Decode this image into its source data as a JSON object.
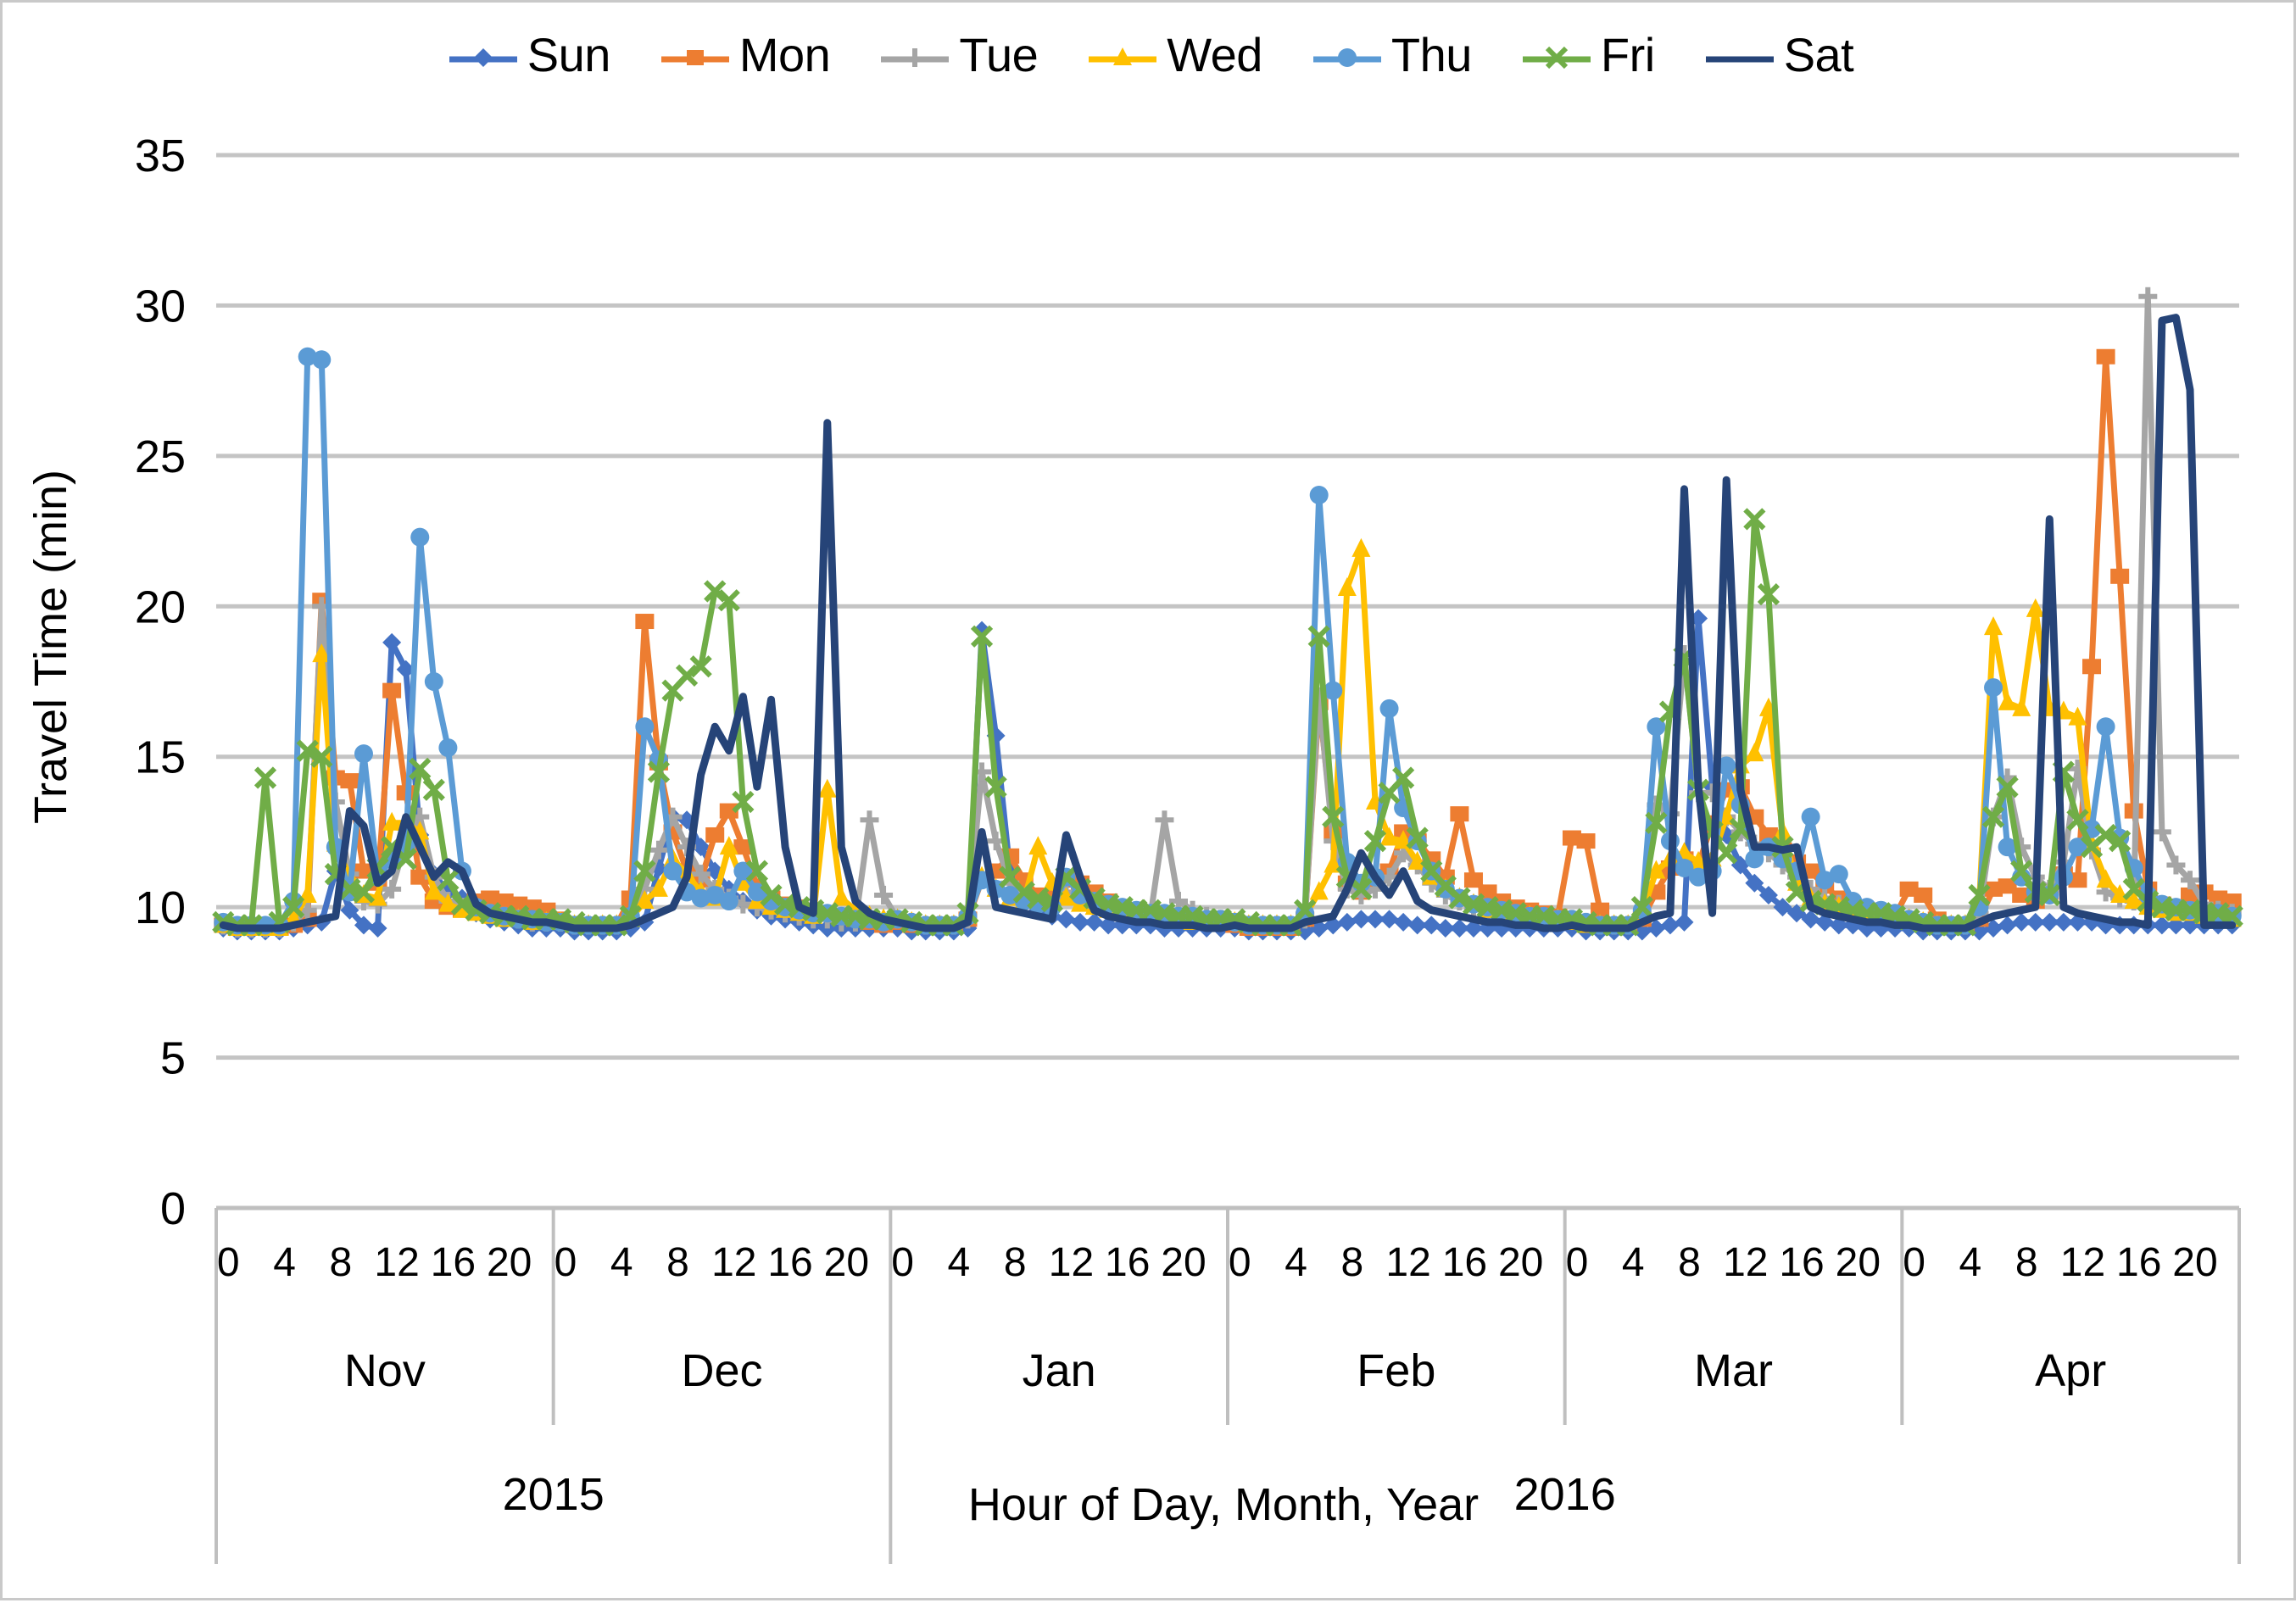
{
  "legend": {
    "position": "top-center",
    "entries": [
      {
        "label": "Sun",
        "color": "#4472C4",
        "marker": "diamond"
      },
      {
        "label": "Mon",
        "color": "#ED7D31",
        "marker": "square"
      },
      {
        "label": "Tue",
        "color": "#A5A5A5",
        "marker": "plus"
      },
      {
        "label": "Wed",
        "color": "#FFC000",
        "marker": "triangle"
      },
      {
        "label": "Thu",
        "color": "#5B9BD5",
        "marker": "circle"
      },
      {
        "label": "Fri",
        "color": "#70AD47",
        "marker": "x"
      },
      {
        "label": "Sat",
        "color": "#264478",
        "marker": "none"
      }
    ]
  },
  "axes": {
    "y_title": "Travel Time (min)",
    "y_ticks": [
      "0",
      "5",
      "10",
      "15",
      "20",
      "25",
      "30",
      "35"
    ],
    "y_min": 0,
    "y_max": 35,
    "x_title": "Hour of Day, Month, Year",
    "hour_ticks": [
      "0",
      "4",
      "8",
      "12",
      "16",
      "20"
    ],
    "months": [
      "Nov",
      "Dec",
      "Jan",
      "Feb",
      "Mar",
      "Apr"
    ],
    "years": [
      {
        "label": "2015",
        "months": 2
      },
      {
        "label": "2016",
        "months": 4
      }
    ]
  },
  "chart_data": {
    "type": "line",
    "title": "",
    "xlabel": "Hour of Day, Month, Year",
    "ylabel": "Travel Time (min)",
    "ylim": [
      0,
      35
    ],
    "ytick_step": 5,
    "grid": "horizontal",
    "legend_position": "top-center",
    "x_groups": [
      "Nov 2015",
      "Dec 2015",
      "Jan 2016",
      "Feb 2016",
      "Mar 2016",
      "Apr 2016"
    ],
    "x_hours_per_group": [
      0,
      4,
      8,
      12,
      16,
      20
    ],
    "x_points_per_group": 24,
    "x_note": "Each month block contains 24 hourly points (hour 0 through 23); all 7 weekday series share the same x grid.",
    "series": [
      {
        "name": "Sun",
        "color": "#4472C4",
        "marker": "diamond",
        "values": [
          9.3,
          9.2,
          9.2,
          9.2,
          9.2,
          9.3,
          9.4,
          9.5,
          11.2,
          9.9,
          9.4,
          9.3,
          18.8,
          17.9,
          12.4,
          11.1,
          10.5,
          10.3,
          9.8,
          9.6,
          9.5,
          9.4,
          9.3,
          9.3,
          9.3,
          9.2,
          9.2,
          9.2,
          9.2,
          9.3,
          9.5,
          11.3,
          13.0,
          12.9,
          12.0,
          11.2,
          10.6,
          10.2,
          9.9,
          9.7,
          9.6,
          9.5,
          9.4,
          9.3,
          9.3,
          9.3,
          9.3,
          9.3,
          9.3,
          9.2,
          9.2,
          9.2,
          9.2,
          9.3,
          19.2,
          15.7,
          11.2,
          10.3,
          9.9,
          9.7,
          9.6,
          9.5,
          9.5,
          9.4,
          9.4,
          9.4,
          9.4,
          9.3,
          9.3,
          9.3,
          9.3,
          9.3,
          9.3,
          9.2,
          9.2,
          9.2,
          9.2,
          9.2,
          9.3,
          9.4,
          9.5,
          9.6,
          9.6,
          9.6,
          9.5,
          9.4,
          9.4,
          9.3,
          9.3,
          9.3,
          9.3,
          9.3,
          9.3,
          9.3,
          9.3,
          9.3,
          9.3,
          9.2,
          9.2,
          9.2,
          9.2,
          9.2,
          9.3,
          9.4,
          9.5,
          19.6,
          14.0,
          12.4,
          11.4,
          10.8,
          10.4,
          10.0,
          9.8,
          9.6,
          9.5,
          9.4,
          9.4,
          9.3,
          9.3,
          9.3,
          9.3,
          9.2,
          9.2,
          9.2,
          9.2,
          9.2,
          9.3,
          9.4,
          9.5,
          9.5,
          9.5,
          9.5,
          9.5,
          9.5,
          9.4,
          9.4,
          9.4,
          9.4,
          9.4,
          9.4,
          9.4,
          9.4,
          9.4,
          9.4
        ]
      },
      {
        "name": "Mon",
        "color": "#ED7D31",
        "marker": "square",
        "values": [
          9.4,
          9.3,
          9.3,
          9.3,
          9.3,
          9.4,
          9.6,
          20.2,
          14.3,
          14.2,
          11.2,
          10.8,
          17.2,
          13.8,
          11.0,
          10.2,
          10.0,
          9.9,
          10.2,
          10.3,
          10.2,
          10.1,
          10.0,
          9.9,
          9.6,
          9.4,
          9.4,
          9.4,
          9.4,
          10.3,
          19.5,
          14.8,
          12.5,
          11.2,
          10.9,
          12.4,
          13.2,
          12.0,
          10.7,
          10.3,
          10.1,
          10.0,
          9.9,
          9.8,
          9.7,
          9.6,
          9.5,
          9.4,
          9.5,
          9.4,
          9.4,
          9.4,
          9.4,
          9.6,
          10.9,
          11.2,
          11.7,
          10.9,
          10.4,
          10.3,
          10.9,
          10.8,
          10.5,
          10.2,
          10.0,
          9.9,
          9.8,
          9.7,
          9.6,
          9.6,
          9.5,
          9.5,
          9.4,
          9.3,
          9.3,
          9.3,
          9.3,
          9.6,
          16.8,
          12.5,
          10.8,
          10.5,
          10.8,
          11.2,
          12.5,
          12.2,
          11.6,
          11.0,
          13.1,
          10.9,
          10.5,
          10.2,
          10.0,
          9.9,
          9.8,
          9.7,
          12.3,
          12.2,
          9.9,
          9.4,
          9.4,
          9.6,
          10.5,
          11.3,
          11.6,
          11.4,
          12.8,
          13.9,
          14.0,
          13.0,
          12.4,
          11.9,
          11.5,
          11.2,
          10.7,
          10.3,
          10.0,
          9.9,
          9.8,
          9.7,
          10.6,
          10.4,
          9.6,
          9.4,
          9.4,
          9.6,
          10.6,
          10.7,
          10.4,
          10.2,
          10.5,
          11.1,
          10.9,
          18.0,
          28.3,
          21.0,
          13.2,
          10.6,
          10.1,
          9.9,
          10.4,
          10.5,
          10.3,
          10.2
        ]
      },
      {
        "name": "Tue",
        "color": "#A5A5A5",
        "marker": "plus",
        "values": [
          9.4,
          9.3,
          9.3,
          9.3,
          9.3,
          9.5,
          9.9,
          20.0,
          13.5,
          11.1,
          10.2,
          10.1,
          10.6,
          12.2,
          13.0,
          11.0,
          10.2,
          10.0,
          9.9,
          9.8,
          9.7,
          9.6,
          9.5,
          9.5,
          9.5,
          9.4,
          9.4,
          9.4,
          9.4,
          9.6,
          10.6,
          11.9,
          13.0,
          12.0,
          11.1,
          10.6,
          10.3,
          10.1,
          10.0,
          9.9,
          9.8,
          9.7,
          9.6,
          9.6,
          9.5,
          9.5,
          12.9,
          10.4,
          9.6,
          9.5,
          9.4,
          9.4,
          9.4,
          9.6,
          14.5,
          12.2,
          10.8,
          10.3,
          10.1,
          10.0,
          10.5,
          10.3,
          10.1,
          10.0,
          9.9,
          9.8,
          9.7,
          12.9,
          10.2,
          9.9,
          9.7,
          9.6,
          9.5,
          9.4,
          9.4,
          9.4,
          9.4,
          9.6,
          17.0,
          12.2,
          10.6,
          10.4,
          10.6,
          11.0,
          11.8,
          11.4,
          10.8,
          10.4,
          10.2,
          10.0,
          9.9,
          9.8,
          9.7,
          9.6,
          9.6,
          9.5,
          9.6,
          9.5,
          9.4,
          9.4,
          9.4,
          9.7,
          13.4,
          13.1,
          18.4,
          13.8,
          13.8,
          13.0,
          12.5,
          12.1,
          11.8,
          11.4,
          11.0,
          10.6,
          10.3,
          10.1,
          9.9,
          9.8,
          9.7,
          9.6,
          9.6,
          9.5,
          9.4,
          9.4,
          9.4,
          9.8,
          13.0,
          14.3,
          12.0,
          11.0,
          10.6,
          11.5,
          14.6,
          11.9,
          10.5,
          10.3,
          10.2,
          30.3,
          12.5,
          11.4,
          10.9,
          10.1,
          9.9,
          9.8
        ]
      },
      {
        "name": "Wed",
        "color": "#FFC000",
        "marker": "triangle",
        "values": [
          9.4,
          9.3,
          9.3,
          9.3,
          9.3,
          9.6,
          10.4,
          18.4,
          12.1,
          11.0,
          10.4,
          10.3,
          12.8,
          12.8,
          12.5,
          10.5,
          10.1,
          9.9,
          9.8,
          9.7,
          9.6,
          9.6,
          9.5,
          9.5,
          9.5,
          9.4,
          9.4,
          9.4,
          9.4,
          9.6,
          10.2,
          10.6,
          11.6,
          11.1,
          10.5,
          10.3,
          12.0,
          10.8,
          10.2,
          10.0,
          9.9,
          9.8,
          9.7,
          13.9,
          10.3,
          9.9,
          9.7,
          9.6,
          9.6,
          9.5,
          9.4,
          9.4,
          9.4,
          9.7,
          11.0,
          10.6,
          10.3,
          10.2,
          12.0,
          10.8,
          10.3,
          10.1,
          10.0,
          9.9,
          9.8,
          9.7,
          9.7,
          9.6,
          9.6,
          9.5,
          9.5,
          9.5,
          9.5,
          9.4,
          9.4,
          9.4,
          9.4,
          9.7,
          10.5,
          11.4,
          20.6,
          21.9,
          13.5,
          12.3,
          12.2,
          11.5,
          11.0,
          10.6,
          10.3,
          10.1,
          9.9,
          9.8,
          9.7,
          9.7,
          9.6,
          9.6,
          9.5,
          9.4,
          9.4,
          9.4,
          9.4,
          9.8,
          11.2,
          11.6,
          11.8,
          11.5,
          11.6,
          13.0,
          14.7,
          15.1,
          16.6,
          12.5,
          10.8,
          10.3,
          10.1,
          10.0,
          9.9,
          9.8,
          9.7,
          9.6,
          9.6,
          9.5,
          9.4,
          9.4,
          9.4,
          10.2,
          19.3,
          16.8,
          16.6,
          19.9,
          16.6,
          16.5,
          16.3,
          12.1,
          10.9,
          10.4,
          10.2,
          10.0,
          9.9,
          9.8,
          9.8,
          9.7,
          9.7,
          9.6
        ]
      },
      {
        "name": "Thu",
        "color": "#5B9BD5",
        "marker": "circle",
        "values": [
          9.5,
          9.4,
          9.4,
          9.4,
          9.4,
          10.2,
          28.3,
          28.2,
          12.0,
          10.5,
          15.1,
          11.0,
          11.6,
          12.0,
          22.3,
          17.5,
          15.3,
          11.2,
          10.0,
          9.8,
          9.7,
          9.6,
          9.6,
          9.5,
          9.5,
          9.4,
          9.4,
          9.4,
          9.4,
          9.7,
          16.0,
          14.9,
          11.2,
          10.5,
          10.3,
          10.4,
          10.2,
          11.2,
          10.5,
          10.2,
          10.0,
          9.9,
          9.8,
          9.8,
          9.7,
          9.6,
          9.6,
          9.5,
          9.6,
          9.5,
          9.4,
          9.4,
          9.4,
          9.7,
          10.9,
          10.6,
          10.4,
          10.2,
          10.1,
          10.0,
          11.0,
          10.4,
          10.2,
          10.1,
          10.0,
          9.9,
          9.8,
          9.8,
          9.7,
          9.7,
          9.6,
          9.6,
          9.5,
          9.4,
          9.4,
          9.4,
          9.4,
          9.8,
          23.7,
          17.2,
          11.5,
          10.8,
          11.0,
          16.6,
          13.3,
          12.2,
          11.2,
          10.6,
          10.3,
          10.1,
          10.0,
          9.9,
          9.8,
          9.7,
          9.7,
          9.6,
          9.6,
          9.5,
          9.4,
          9.4,
          9.4,
          9.9,
          16.0,
          12.2,
          11.3,
          11.0,
          11.2,
          14.7,
          13.4,
          11.6,
          12.0,
          11.6,
          11.2,
          13.0,
          10.9,
          11.1,
          10.2,
          10.0,
          9.9,
          9.8,
          9.6,
          9.5,
          9.4,
          9.4,
          9.4,
          10.0,
          17.3,
          12.0,
          11.0,
          10.5,
          10.4,
          11.0,
          12.0,
          12.6,
          16.0,
          12.3,
          11.3,
          10.4,
          10.1,
          10.0,
          9.9,
          9.8,
          9.8,
          9.7
        ]
      },
      {
        "name": "Fri",
        "color": "#70AD47",
        "marker": "x",
        "values": [
          9.5,
          9.4,
          9.4,
          14.3,
          9.5,
          10.0,
          15.2,
          15.0,
          11.1,
          10.6,
          10.5,
          11.3,
          12.0,
          11.6,
          14.6,
          13.9,
          10.9,
          10.1,
          9.9,
          9.8,
          9.7,
          9.7,
          9.6,
          9.6,
          9.6,
          9.5,
          9.4,
          9.4,
          9.4,
          9.7,
          11.2,
          14.5,
          17.2,
          17.7,
          18.0,
          20.5,
          20.2,
          13.5,
          11.2,
          10.4,
          10.1,
          10.0,
          9.9,
          9.8,
          9.7,
          9.7,
          9.6,
          9.6,
          9.6,
          9.5,
          9.4,
          9.4,
          9.4,
          9.8,
          19.0,
          14.0,
          11.0,
          10.5,
          10.3,
          10.2,
          11.0,
          10.6,
          10.3,
          10.1,
          10.0,
          9.9,
          9.9,
          9.8,
          9.7,
          9.7,
          9.6,
          9.6,
          9.6,
          9.5,
          9.4,
          9.4,
          9.4,
          9.9,
          19.0,
          13.0,
          11.0,
          10.6,
          12.2,
          13.8,
          14.3,
          12.3,
          11.2,
          10.7,
          10.3,
          10.1,
          10.0,
          9.9,
          9.8,
          9.7,
          9.7,
          9.6,
          9.6,
          9.5,
          9.4,
          9.4,
          9.4,
          10.0,
          12.8,
          16.5,
          18.3,
          13.9,
          12.5,
          11.8,
          12.6,
          22.9,
          20.4,
          12.0,
          10.5,
          10.2,
          10.1,
          10.0,
          9.9,
          9.8,
          9.8,
          9.7,
          9.6,
          9.5,
          9.4,
          9.4,
          9.4,
          10.4,
          13.0,
          14.0,
          11.2,
          10.5,
          10.4,
          14.5,
          12.9,
          12.0,
          12.4,
          12.2,
          10.6,
          10.2,
          10.0,
          9.9,
          9.9,
          9.8,
          9.8,
          9.7
        ]
      },
      {
        "name": "Sat",
        "color": "#264478",
        "marker": "none",
        "values": [
          9.4,
          9.3,
          9.3,
          9.3,
          9.3,
          9.4,
          9.5,
          9.6,
          9.7,
          13.2,
          12.7,
          10.8,
          11.2,
          13.0,
          12.0,
          11.0,
          11.5,
          11.2,
          10.1,
          9.8,
          9.7,
          9.6,
          9.5,
          9.5,
          9.4,
          9.3,
          9.3,
          9.3,
          9.3,
          9.4,
          9.6,
          9.8,
          10.0,
          11.0,
          14.4,
          16.0,
          15.2,
          17.0,
          14.0,
          16.9,
          12.0,
          10.0,
          9.8,
          26.1,
          12.0,
          10.2,
          9.8,
          9.6,
          9.5,
          9.4,
          9.3,
          9.3,
          9.3,
          9.5,
          12.5,
          10.0,
          9.9,
          9.8,
          9.7,
          9.6,
          12.4,
          11.0,
          9.9,
          9.7,
          9.6,
          9.5,
          9.5,
          9.4,
          9.4,
          9.4,
          9.3,
          9.3,
          9.4,
          9.3,
          9.3,
          9.3,
          9.3,
          9.5,
          9.6,
          9.7,
          10.6,
          11.8,
          11.0,
          10.4,
          11.2,
          10.2,
          9.9,
          9.8,
          9.7,
          9.6,
          9.5,
          9.5,
          9.4,
          9.4,
          9.3,
          9.3,
          9.4,
          9.3,
          9.3,
          9.3,
          9.3,
          9.5,
          9.7,
          9.8,
          23.9,
          14.0,
          9.8,
          24.2,
          13.9,
          12.0,
          12.0,
          11.9,
          12.0,
          10.0,
          9.8,
          9.7,
          9.6,
          9.5,
          9.5,
          9.4,
          9.4,
          9.3,
          9.3,
          9.3,
          9.3,
          9.5,
          9.7,
          9.8,
          9.9,
          10.0,
          22.9,
          10.0,
          9.8,
          9.7,
          9.6,
          9.5,
          9.5,
          9.4,
          29.5,
          29.6,
          27.2,
          9.4,
          9.4,
          9.4
        ]
      }
    ]
  }
}
